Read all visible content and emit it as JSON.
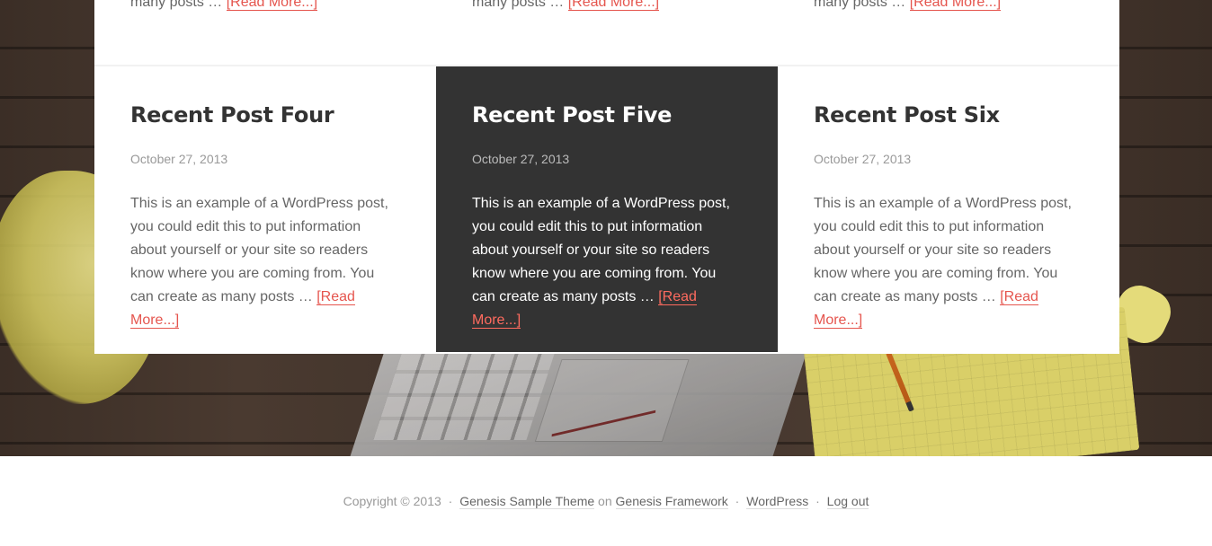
{
  "top_row": {
    "items": [
      {
        "text": "many posts … ",
        "read_more": "[Read More...]"
      },
      {
        "text": "many posts … ",
        "read_more": "[Read More...]"
      },
      {
        "text": "many posts … ",
        "read_more": "[Read More...]"
      }
    ]
  },
  "posts": [
    {
      "title": "Recent Post Four",
      "date": "October 27, 2013",
      "excerpt": "This is an example of a WordPress post, you could edit this to put information about yourself or your site so readers know where you are coming from. You can create as many posts … ",
      "read_more": "[Read More...]"
    },
    {
      "title": "Recent Post Five",
      "date": "October 27, 2013",
      "excerpt": "This is an example of a WordPress post, you could edit this to put information about yourself or your site so readers know where you are coming from. You can create as many posts … ",
      "read_more": "[Read More...]"
    },
    {
      "title": "Recent Post Six",
      "date": "October 27, 2013",
      "excerpt": "This is an example of a WordPress post, you could edit this to put information about yourself or your site so readers know where you are coming from. You can create as many posts … ",
      "read_more": "[Read More...]"
    }
  ],
  "footer": {
    "copyright": "Copyright © 2013",
    "sep": "·",
    "theme_link": "Genesis Sample Theme",
    "on": "on",
    "framework_link": "Genesis Framework",
    "wordpress_link": "WordPress",
    "logout_link": "Log out"
  },
  "colors": {
    "accent": "#e5554e",
    "dark_panel": "#333333",
    "text": "#666666"
  }
}
